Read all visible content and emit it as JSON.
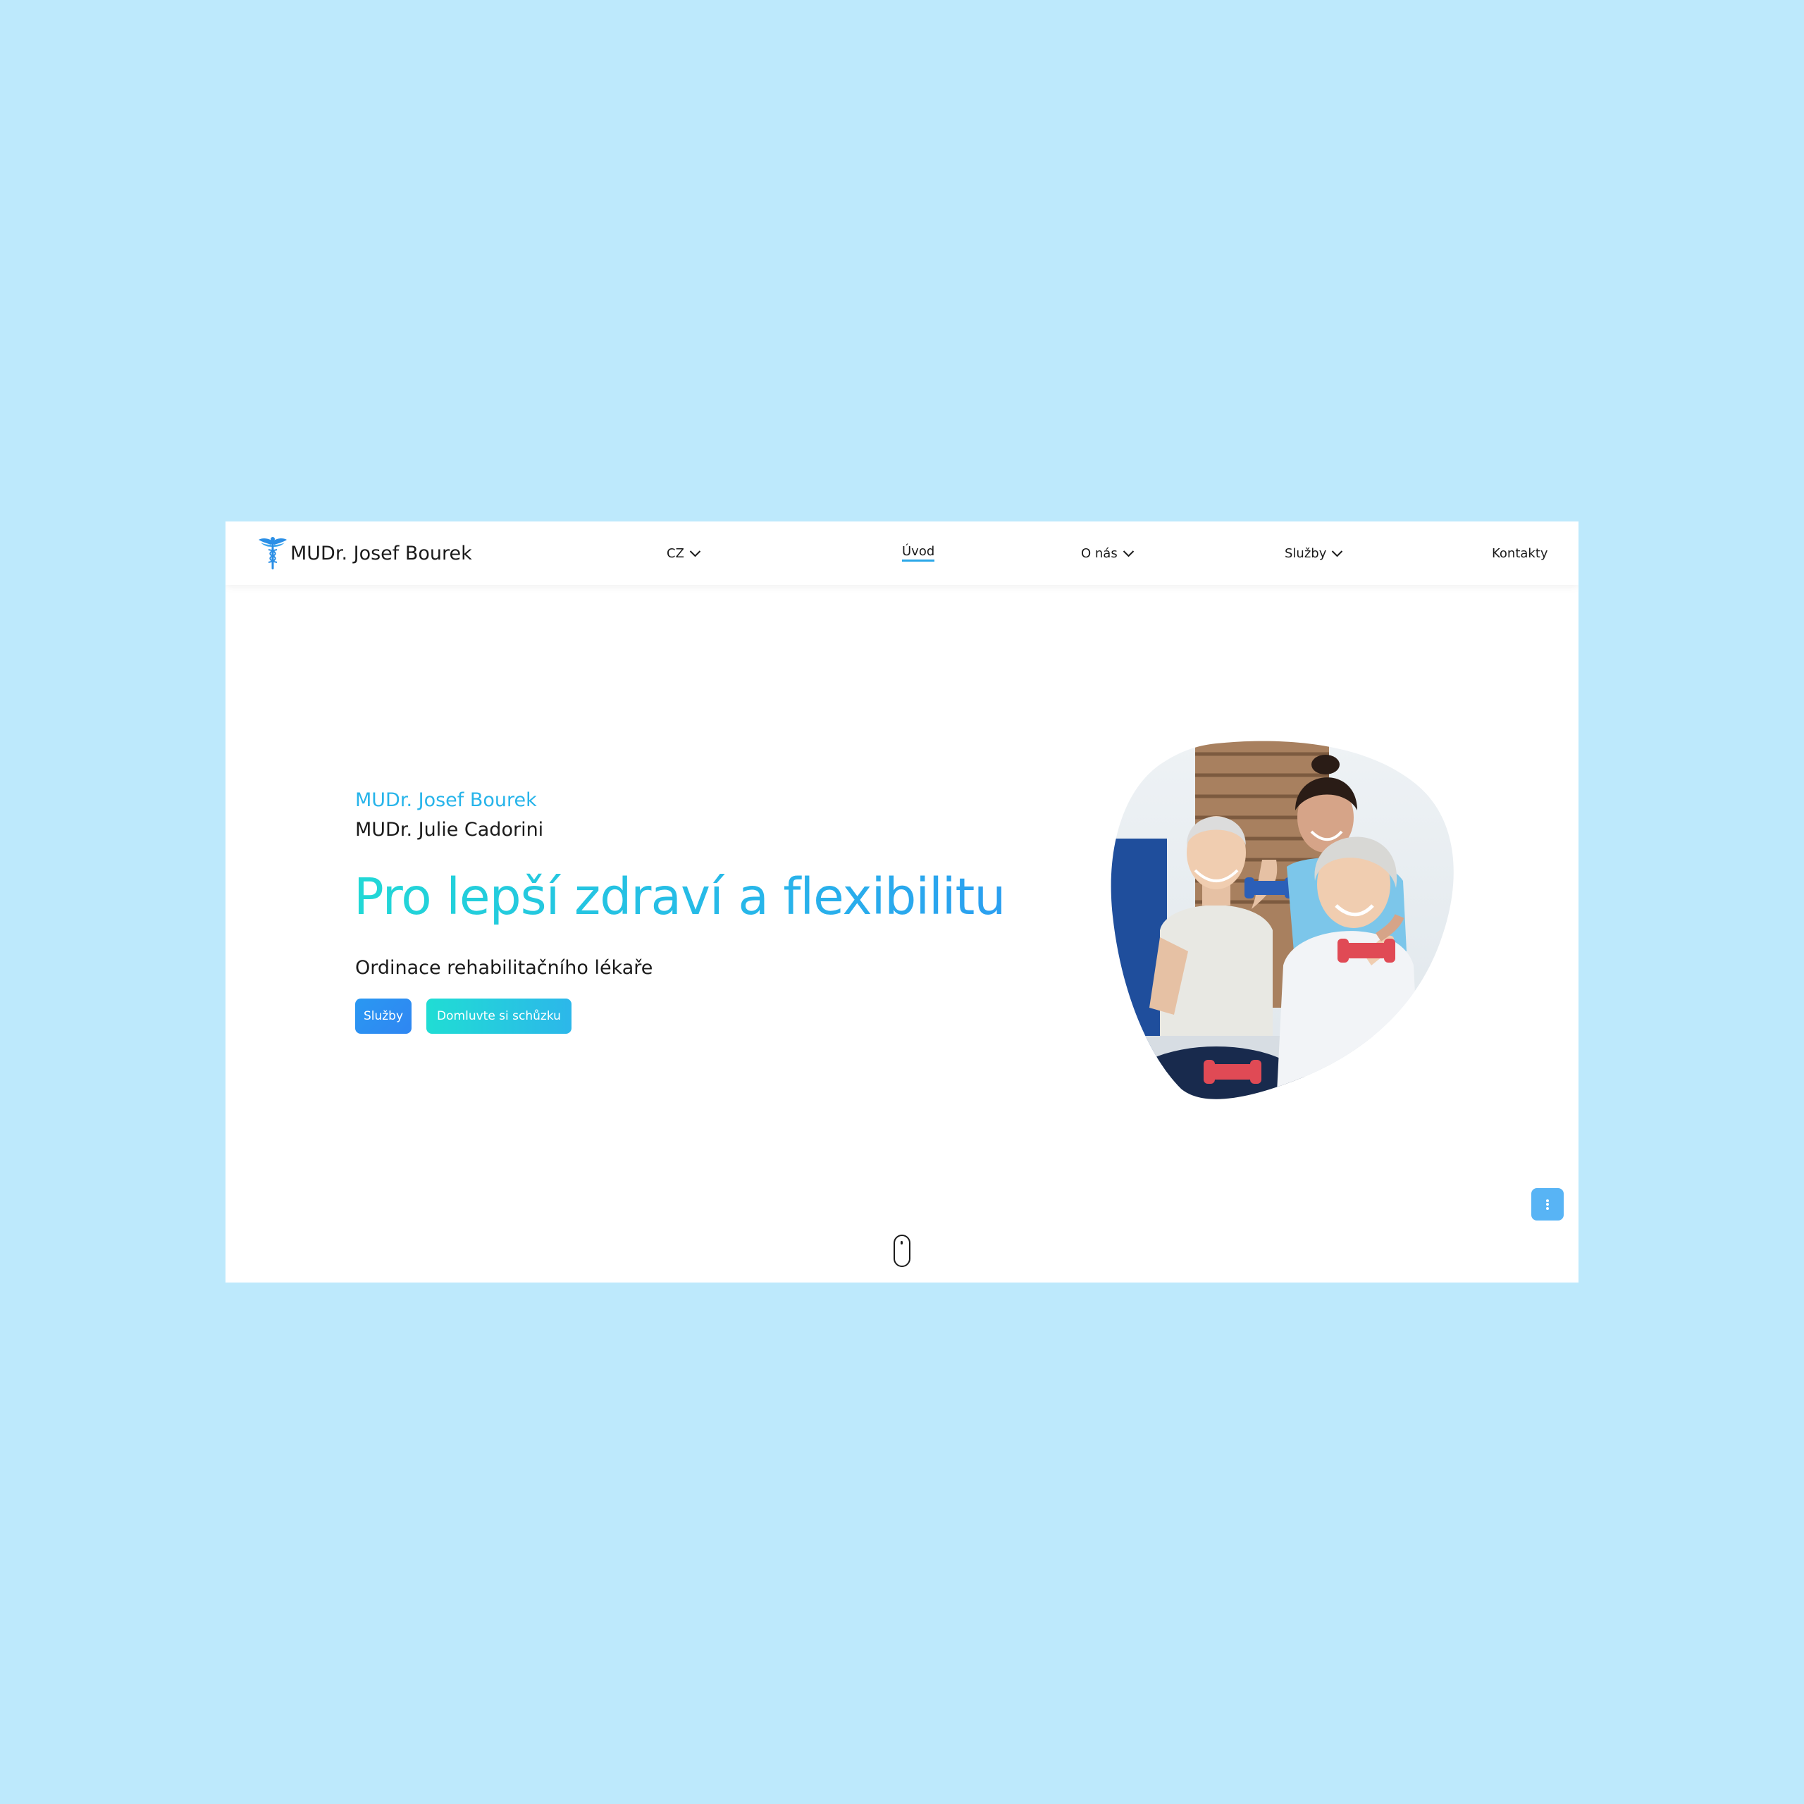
{
  "header": {
    "brand": "MUDr. Josef Bourek",
    "lang": "CZ",
    "nav": {
      "home": "Úvod",
      "about": "O nás",
      "services": "Služby",
      "contacts": "Kontakty"
    }
  },
  "hero": {
    "doctor_primary": "MUDr. Josef Bourek",
    "doctor_secondary": "MUDr. Julie Cadorini",
    "title": "Pro lepší zdraví a flexibilitu",
    "description": "Ordinace rehabilitačního lékaře",
    "buttons": {
      "services": "Služby",
      "appointment": "Domluvte si schůzku"
    }
  },
  "colors": {
    "page_background": "#bde9fc",
    "accent_blue": "#2a98f2",
    "accent_teal": "#20ddd4",
    "text_dark": "#1b1b1b"
  },
  "icons": {
    "logo": "caduceus-icon",
    "dropdown": "chevron-down-icon",
    "menu": "more-vertical-icon",
    "scroll": "scroll-mouse-icon"
  }
}
